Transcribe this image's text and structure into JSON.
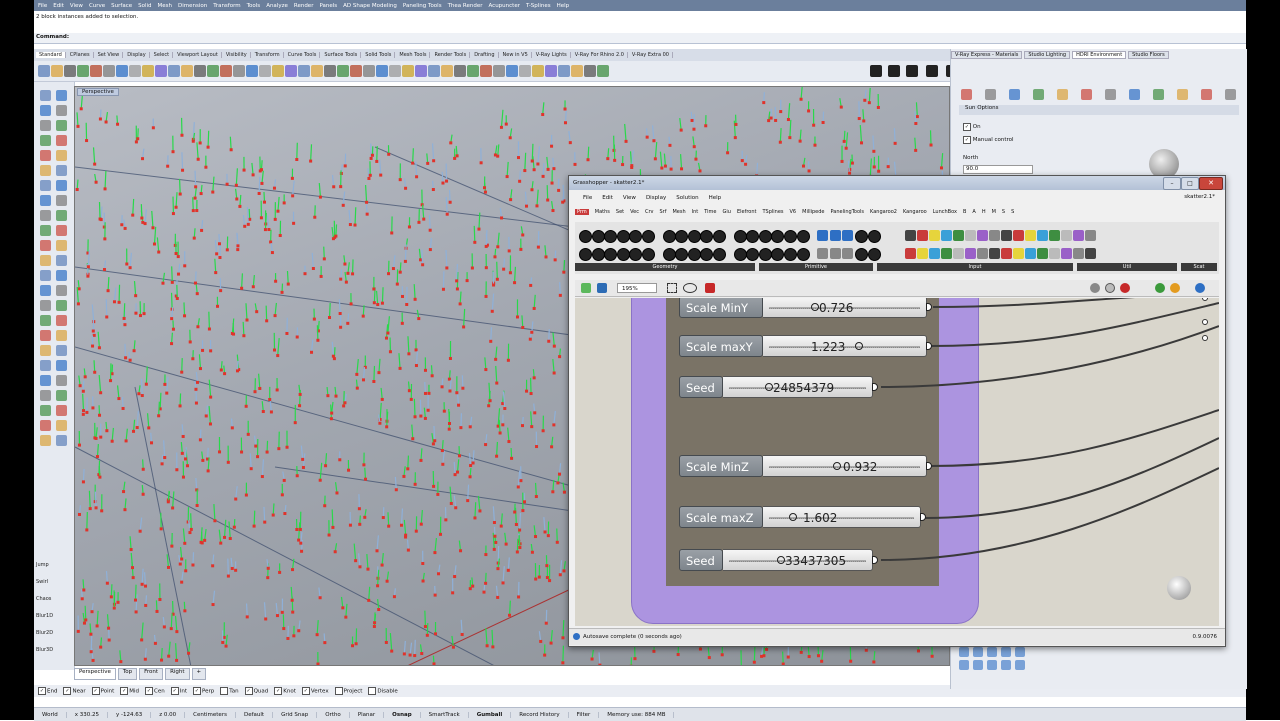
{
  "rhino": {
    "menu": [
      "File",
      "Edit",
      "View",
      "Curve",
      "Surface",
      "Solid",
      "Mesh",
      "Dimension",
      "Transform",
      "Tools",
      "Analyze",
      "Render",
      "Panels",
      "AD Shape Modeling",
      "Paneling Tools",
      "Thea Render",
      "Acupuncter",
      "T-Splines",
      "Help"
    ],
    "history_line": "2 block instances added to selection.",
    "command_label": "Command:",
    "tabs": [
      "Standard",
      "CPlanes",
      "Set View",
      "Display",
      "Select",
      "Viewport Layout",
      "Visibility",
      "Transform",
      "Curve Tools",
      "Surface Tools",
      "Solid Tools",
      "Mesh Tools",
      "Render Tools",
      "Drafting",
      "New in V5",
      "V-Ray Lights",
      "V-Ray For Rhino 2.0",
      "V-Ray Extra 00"
    ],
    "viewport_title": "Perspective",
    "view_tabs": [
      "Perspective",
      "Top",
      "Front",
      "Right"
    ],
    "left_labels": [
      "Jump",
      "Swirl",
      "Chaos",
      "Blur1D",
      "Blur2D",
      "Blur3D"
    ],
    "osnaps": [
      {
        "label": "End",
        "checked": true
      },
      {
        "label": "Near",
        "checked": true
      },
      {
        "label": "Point",
        "checked": true
      },
      {
        "label": "Mid",
        "checked": true
      },
      {
        "label": "Cen",
        "checked": true
      },
      {
        "label": "Int",
        "checked": true
      },
      {
        "label": "Perp",
        "checked": true
      },
      {
        "label": "Tan",
        "checked": false
      },
      {
        "label": "Quad",
        "checked": true
      },
      {
        "label": "Knot",
        "checked": true
      },
      {
        "label": "Vertex",
        "checked": true
      },
      {
        "label": "Project",
        "checked": false
      },
      {
        "label": "Disable",
        "checked": false
      }
    ],
    "status": {
      "cplane": "World",
      "x": "x 330.25",
      "y": "y -124.63",
      "z": "z 0.00",
      "units": "Centimeters",
      "layer": "Default",
      "grid_snap": "Grid Snap",
      "ortho": "Ortho",
      "planar": "Planar",
      "osnap": "Osnap",
      "smarttrack": "SmartTrack",
      "gumball": "Gumball",
      "record_history": "Record History",
      "filter": "Filter",
      "memory": "Memory use: 884 MB"
    },
    "right_tabs": [
      "V-Ray Express - Materials",
      "Studio Lighting",
      "HDRI Environment",
      "Studio Floors"
    ],
    "sun_options": {
      "header": "Sun Options",
      "on_label": "On",
      "manual_label": "Manual control",
      "north_label": "North",
      "north_value": "90.0"
    }
  },
  "grasshopper": {
    "title": "Grasshopper - skatter2.1*",
    "menu": [
      "File",
      "Edit",
      "View",
      "Display",
      "Solution",
      "Help"
    ],
    "file_label": "skatter2.1*",
    "tabs": [
      "Prm",
      "Maths",
      "Set",
      "Vec",
      "Crv",
      "Srf",
      "Mesh",
      "Int",
      "Time",
      "Giu",
      "Elefront",
      "TSplines",
      "V6",
      "Millipede",
      "PanelingTools",
      "Kangaroo2",
      "Kangaroo",
      "LunchBox",
      "B",
      "A",
      "H",
      "M",
      "S",
      "S"
    ],
    "ribbon_labels": [
      "Geometry",
      "Primitive",
      "Input",
      "Util",
      "Scat"
    ],
    "zoom": "195%",
    "sliders": [
      {
        "label": "Scale MinY",
        "value": "0.726"
      },
      {
        "label": "Scale maxY",
        "value": "1.223"
      },
      {
        "label": "Seed",
        "value": "24854379"
      },
      {
        "label": "Scale MinZ",
        "value": "0.932"
      },
      {
        "label": "Scale maxZ",
        "value": "1.602"
      },
      {
        "label": "Seed",
        "value": "33437305"
      }
    ],
    "status_msg": "Autosave complete (0 seconds ago)",
    "version": "0.9.0076"
  }
}
